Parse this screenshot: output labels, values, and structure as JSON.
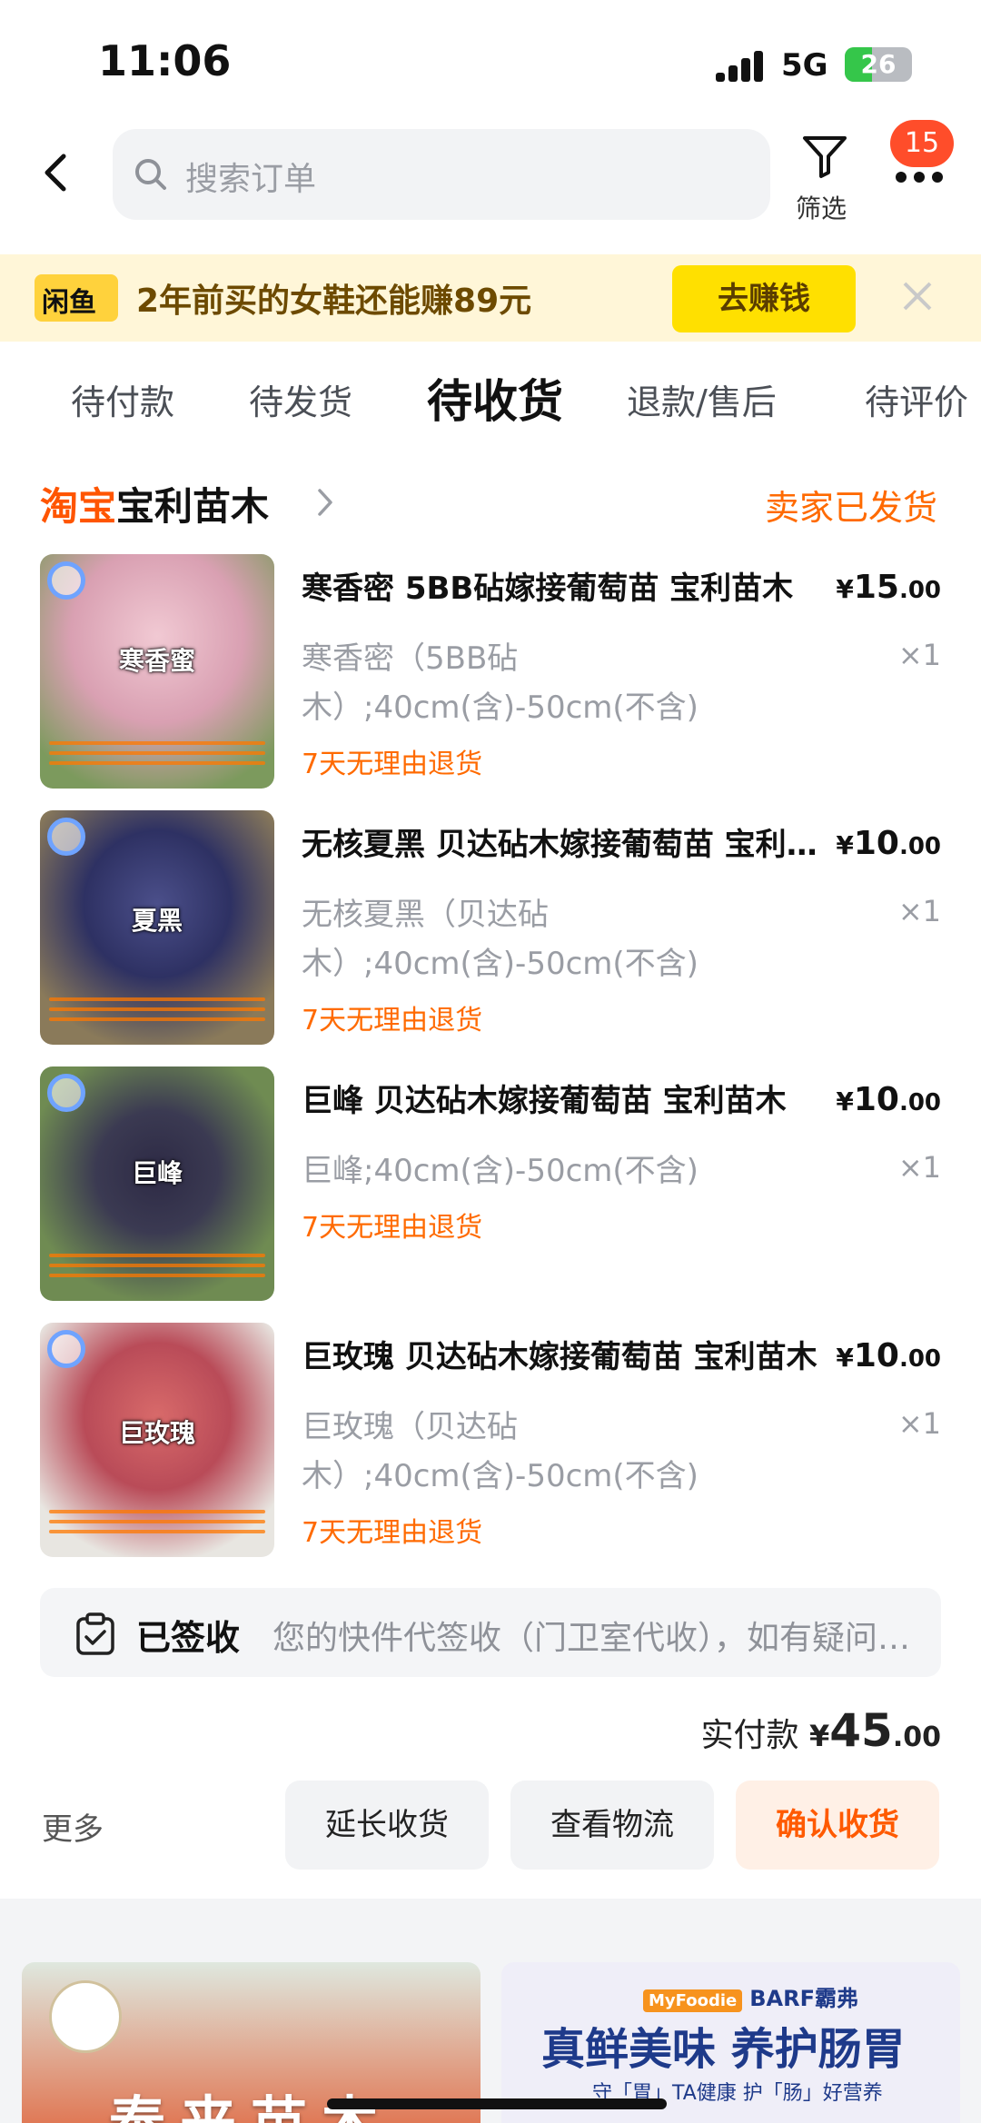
{
  "status_bar": {
    "time": "11:06",
    "network": "5G",
    "battery": "26"
  },
  "header": {
    "search_placeholder": "搜索订单",
    "filter_label": "筛选",
    "message_badge": "15"
  },
  "promo": {
    "brand": "闲鱼",
    "text": "2年前买的女鞋还能赚89元",
    "button": "去赚钱"
  },
  "tabs": [
    "待付款",
    "待发货",
    "待收货",
    "退款/售后",
    "待评价"
  ],
  "active_tab": "待收货",
  "order": {
    "platform": "淘宝",
    "shop_name": "宝利苗木",
    "status": "卖家已发货",
    "items": [
      {
        "image_label": "寒香蜜",
        "title": "寒香密  5BB砧嫁接葡萄苗 宝利苗木",
        "currency": "¥",
        "price_int": "15",
        "price_dec": ".00",
        "sku": "寒香密（5BB砧木）;40cm(含)-50cm(不含)",
        "qty": "×1",
        "refund": "7天无理由退货"
      },
      {
        "image_label": "夏黑",
        "title": "无核夏黑 贝达砧木嫁接葡萄苗 宝利苗木",
        "currency": "¥",
        "price_int": "10",
        "price_dec": ".00",
        "sku": "无核夏黑（贝达砧木）;40cm(含)-50cm(不含)",
        "qty": "×1",
        "refund": "7天无理由退货"
      },
      {
        "image_label": "巨峰",
        "title": "巨峰  贝达砧木嫁接葡萄苗 宝利苗木",
        "currency": "¥",
        "price_int": "10",
        "price_dec": ".00",
        "sku": "巨峰;40cm(含)-50cm(不含)",
        "qty": "×1",
        "refund": "7天无理由退货"
      },
      {
        "image_label": "巨玫瑰",
        "title": "巨玫瑰 贝达砧木嫁接葡萄苗 宝利苗木",
        "currency": "¥",
        "price_int": "10",
        "price_dec": ".00",
        "sku": "巨玫瑰（贝达砧木）;40cm(含)-50cm(不含)",
        "qty": "×1",
        "refund": "7天无理由退货"
      }
    ],
    "delivery": {
      "status": "已签收",
      "message": "您的快件代签收（门卫室代收），如有疑问请联系"
    },
    "paid": {
      "label": "实付款",
      "currency": "¥",
      "int": "45",
      "dec": ".00"
    },
    "actions": {
      "more": "更多",
      "extend": "延长收货",
      "logistics": "查看物流",
      "confirm": "确认收货"
    }
  },
  "recommendations": [
    {
      "title": "泰来苗木"
    },
    {
      "brand": "BARF霸弗",
      "mini": "MyFoodie",
      "headline": "真鲜美味 养护肠胃",
      "sub": "守「胃」TA健康 护「肠」好营养"
    }
  ],
  "colors": {
    "accent": "#ff6a00",
    "taobao": "#ff5500",
    "badge": "#ff4d2a",
    "promo_bg": "#fff6d8",
    "promo_btn": "#ffe000"
  }
}
